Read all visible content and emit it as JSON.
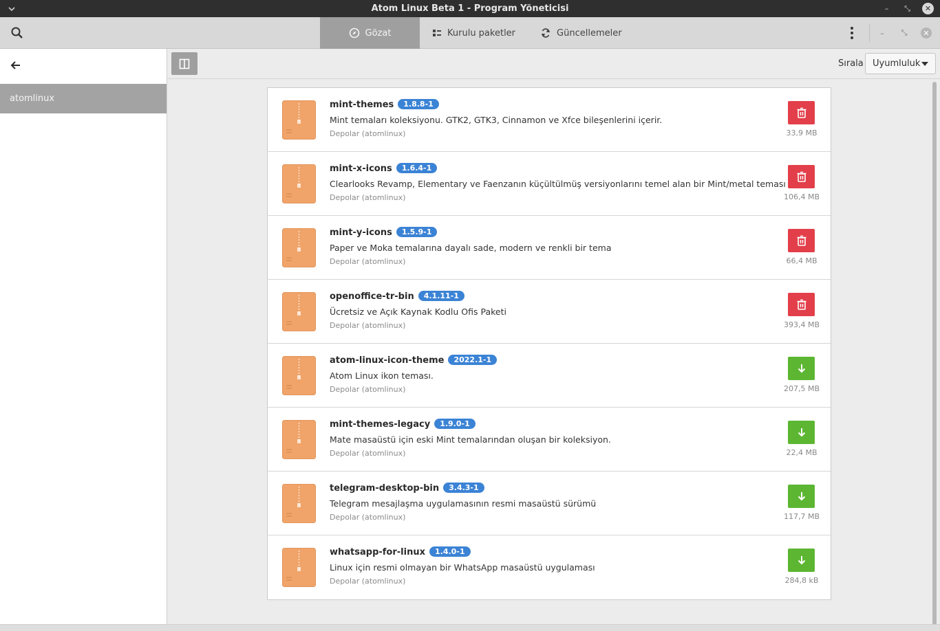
{
  "window": {
    "title": "Atom Linux Beta 1 - Program Yöneticisi"
  },
  "tabs": [
    {
      "label": "Gözat",
      "icon": "compass-icon",
      "active": true
    },
    {
      "label": "Kurulu paketler",
      "icon": "grid-list-icon",
      "active": false
    },
    {
      "label": "Güncellemeler",
      "icon": "refresh-icon",
      "active": false
    }
  ],
  "sidebar": {
    "items": [
      {
        "label": "atomlinux",
        "selected": true
      }
    ]
  },
  "toolbar": {
    "sort_label": "Sırala",
    "sort_value": "Uyumluluk"
  },
  "colors": {
    "remove": "#e23f4a",
    "install": "#5cb632",
    "badge": "#3b83d5",
    "active_tab": "#9f9f9f"
  },
  "packages": [
    {
      "name": "mint-themes",
      "version": "1.8.8-1",
      "description": "Mint temaları koleksiyonu. GTK2, GTK3, Cinnamon ve Xfce bileşenlerini içerir.",
      "repo": "Depolar (atomlinux)",
      "size": "33,9 MB",
      "action": "remove"
    },
    {
      "name": "mint-x-icons",
      "version": "1.6.4-1",
      "description": "Clearlooks Revamp, Elementary ve Faenzanın küçültülmüş versiyonlarını temel alan bir Mint/metal teması",
      "repo": "Depolar (atomlinux)",
      "size": "106,4 MB",
      "action": "remove"
    },
    {
      "name": "mint-y-icons",
      "version": "1.5.9-1",
      "description": "Paper ve Moka temalarına dayalı sade, modern ve renkli bir tema",
      "repo": "Depolar (atomlinux)",
      "size": "66,4 MB",
      "action": "remove"
    },
    {
      "name": "openoffice-tr-bin",
      "version": "4.1.11-1",
      "description": "Ücretsiz ve Açık Kaynak Kodlu Ofis Paketi",
      "repo": "Depolar (atomlinux)",
      "size": "393,4 MB",
      "action": "remove"
    },
    {
      "name": "atom-linux-icon-theme",
      "version": "2022.1-1",
      "description": "Atom Linux ikon teması.",
      "repo": "Depolar (atomlinux)",
      "size": "207,5 MB",
      "action": "install"
    },
    {
      "name": "mint-themes-legacy",
      "version": "1.9.0-1",
      "description": "Mate masaüstü için eski Mint temalarından oluşan bir koleksiyon.",
      "repo": "Depolar (atomlinux)",
      "size": "22,4 MB",
      "action": "install"
    },
    {
      "name": "telegram-desktop-bin",
      "version": "3.4.3-1",
      "description": "Telegram mesajlaşma uygulamasının resmi masaüstü sürümü",
      "repo": "Depolar (atomlinux)",
      "size": "117,7 MB",
      "action": "install"
    },
    {
      "name": "whatsapp-for-linux",
      "version": "1.4.0-1",
      "description": "Linux için resmi olmayan bir WhatsApp masaüstü uygulaması",
      "repo": "Depolar (atomlinux)",
      "size": "284,8 kB",
      "action": "install"
    }
  ]
}
